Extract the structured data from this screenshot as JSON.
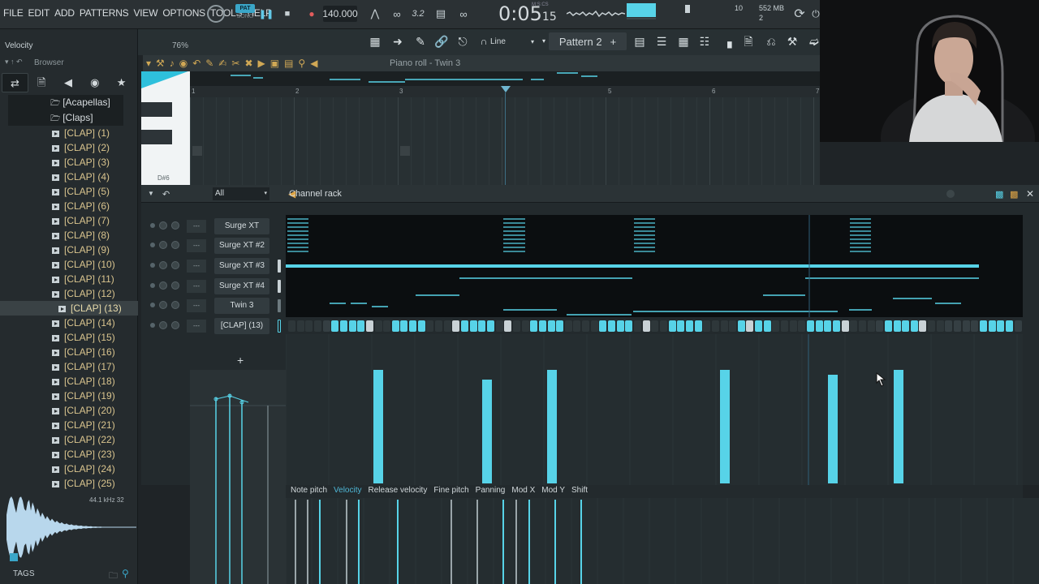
{
  "menu": [
    "FILE",
    "EDIT",
    "ADD",
    "PATTERNS",
    "VIEW",
    "OPTIONS",
    "TOOLS",
    "HELP"
  ],
  "transport": {
    "pat_label": "PAT",
    "song_label": "SONG",
    "tempo": "140.000",
    "time_main": "0:05",
    "time_sub": "15",
    "time_unit": "M:S:CS",
    "snap_value": "3.2",
    "mem": "552 MB",
    "mem_sub": "2",
    "poly": "10"
  },
  "toolbar": {
    "line_mode": "Line",
    "pattern": "Pattern 2",
    "pattern_add": "+"
  },
  "left_panel": {
    "hint_label": "Velocity",
    "hint_value": "76%",
    "browser_label": "Browser",
    "tree": [
      {
        "label": "[Acapellas]",
        "type": "folder"
      },
      {
        "label": "[Claps]",
        "type": "folder"
      },
      {
        "label": "[CLAP] (1)"
      },
      {
        "label": "[CLAP] (2)"
      },
      {
        "label": "[CLAP] (3)"
      },
      {
        "label": "[CLAP] (4)"
      },
      {
        "label": "[CLAP] (5)"
      },
      {
        "label": "[CLAP] (6)"
      },
      {
        "label": "[CLAP] (7)"
      },
      {
        "label": "[CLAP] (8)"
      },
      {
        "label": "[CLAP] (9)"
      },
      {
        "label": "[CLAP] (10)"
      },
      {
        "label": "[CLAP] (11)"
      },
      {
        "label": "[CLAP] (12)"
      },
      {
        "label": "[CLAP] (13)",
        "selected": true
      },
      {
        "label": "[CLAP] (14)"
      },
      {
        "label": "[CLAP] (15)"
      },
      {
        "label": "[CLAP] (16)"
      },
      {
        "label": "[CLAP] (17)"
      },
      {
        "label": "[CLAP] (18)"
      },
      {
        "label": "[CLAP] (19)"
      },
      {
        "label": "[CLAP] (20)"
      },
      {
        "label": "[CLAP] (21)"
      },
      {
        "label": "[CLAP] (22)"
      },
      {
        "label": "[CLAP] (23)"
      },
      {
        "label": "[CLAP] (24)"
      },
      {
        "label": "[CLAP] (25)"
      }
    ],
    "sample_info": "44.1 kHz 32",
    "tags": "TAGS"
  },
  "piano_roll": {
    "title": "Piano roll - Twin 3",
    "key_label": "D#6",
    "bars": [
      "1",
      "2",
      "3",
      "5",
      "6",
      "7"
    ]
  },
  "channel_rack": {
    "title": "Channel rack",
    "filter": "All",
    "add": "+",
    "channels": [
      {
        "name": "Surge XT"
      },
      {
        "name": "Surge XT #2"
      },
      {
        "name": "Surge XT #3"
      },
      {
        "name": "Surge XT #4"
      },
      {
        "name": "Twin 3"
      },
      {
        "name": "[CLAP] (13)"
      }
    ],
    "mixer_label": "---"
  },
  "event_editor": {
    "tabs": [
      "Note pitch",
      "Velocity",
      "Release velocity",
      "Fine pitch",
      "Panning",
      "Mod X",
      "Mod Y",
      "Shift"
    ],
    "active_tab": "Velocity"
  },
  "colors": {
    "accent": "#57d3e8",
    "bg": "#1f2427",
    "folder_text": "#d9c48e"
  }
}
